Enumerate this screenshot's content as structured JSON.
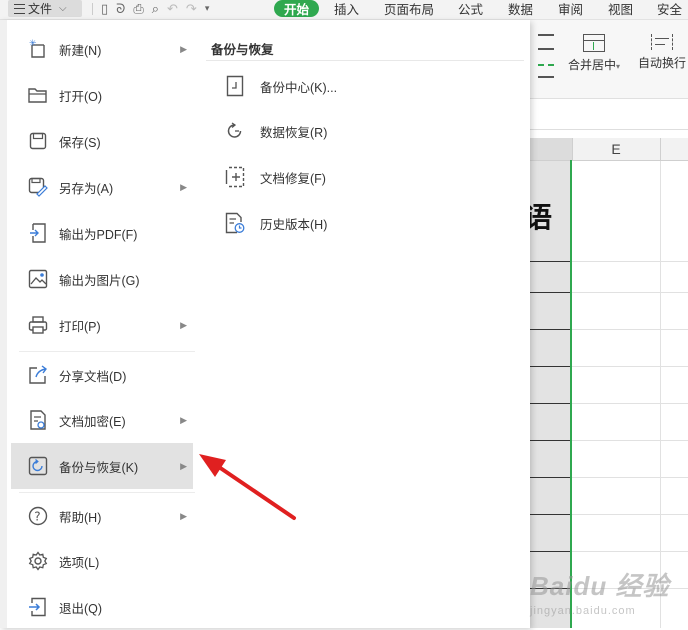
{
  "topbar": {
    "file_label": "文件",
    "tabs": [
      "开始",
      "插入",
      "页面布局",
      "公式",
      "数据",
      "审阅",
      "视图",
      "安全"
    ]
  },
  "ribbon": {
    "merge_label": "合并居中",
    "wrap_label": "自动换行"
  },
  "sheet": {
    "column_e": "E",
    "cell_char": "语"
  },
  "file_menu": {
    "items": [
      {
        "label": "新建(N)",
        "icon": "new-icon",
        "has_submenu": true
      },
      {
        "label": "打开(O)",
        "icon": "folder-open-icon",
        "has_submenu": false
      },
      {
        "label": "保存(S)",
        "icon": "save-icon",
        "has_submenu": false
      },
      {
        "label": "另存为(A)",
        "icon": "save-as-icon",
        "has_submenu": true
      },
      {
        "label": "输出为PDF(F)",
        "icon": "export-pdf-icon",
        "has_submenu": false
      },
      {
        "label": "输出为图片(G)",
        "icon": "export-image-icon",
        "has_submenu": false
      },
      {
        "label": "打印(P)",
        "icon": "printer-icon",
        "has_submenu": true
      },
      {
        "label": "分享文档(D)",
        "icon": "share-icon",
        "has_submenu": false
      },
      {
        "label": "文档加密(E)",
        "icon": "encrypt-icon",
        "has_submenu": true
      },
      {
        "label": "备份与恢复(K)",
        "icon": "backup-restore-icon",
        "has_submenu": true,
        "active": true
      },
      {
        "label": "帮助(H)",
        "icon": "help-icon",
        "has_submenu": true
      },
      {
        "label": "选项(L)",
        "icon": "gear-icon",
        "has_submenu": false
      },
      {
        "label": "退出(Q)",
        "icon": "exit-icon",
        "has_submenu": false
      }
    ]
  },
  "submenu": {
    "title": "备份与恢复",
    "items": [
      {
        "label": "备份中心(K)...",
        "icon": "backup-center-icon"
      },
      {
        "label": "数据恢复(R)",
        "icon": "data-recovery-icon"
      },
      {
        "label": "文档修复(F)",
        "icon": "document-repair-icon"
      },
      {
        "label": "历史版本(H)",
        "icon": "history-version-icon"
      }
    ]
  },
  "watermark": {
    "main": "Baidu 经验",
    "sub": "jingyan.baidu.com"
  },
  "colors": {
    "accent_green": "#2fa84f",
    "arrow_red": "#e02020"
  }
}
